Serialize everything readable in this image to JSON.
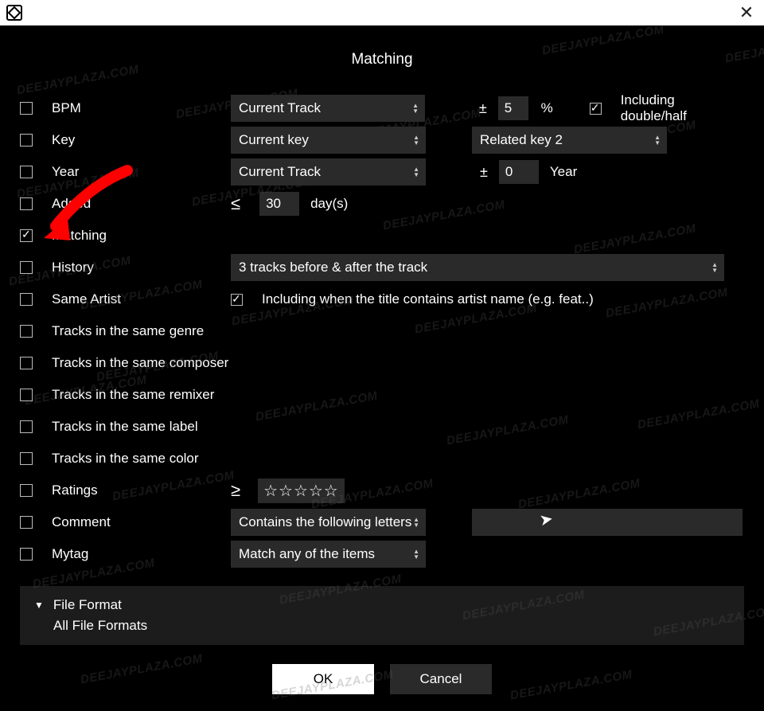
{
  "title": "Matching",
  "watermark": "DEEJAYPLAZA.COM",
  "rows": {
    "bpm": {
      "label": "BPM",
      "select": "Current Track",
      "val": "5",
      "unit": "%",
      "incl_label": "Including double/half"
    },
    "key": {
      "label": "Key",
      "select1": "Current key",
      "select2": "Related key 2"
    },
    "year": {
      "label": "Year",
      "select": "Current Track",
      "val": "0",
      "unit": "Year"
    },
    "added": {
      "label": "Added",
      "val": "30",
      "unit": "day(s)"
    },
    "matching": {
      "label": "Matching"
    },
    "history": {
      "label": "History",
      "select": "3 tracks before & after the track"
    },
    "same_artist": {
      "label": "Same Artist",
      "sub": "Including when the title contains artist name (e.g. feat..)"
    },
    "genre": {
      "label": "Tracks in the same genre"
    },
    "composer": {
      "label": "Tracks in the same composer"
    },
    "remixer": {
      "label": "Tracks in the same remixer"
    },
    "t_label": {
      "label": "Tracks in the same label"
    },
    "color": {
      "label": "Tracks in the same color"
    },
    "ratings": {
      "label": "Ratings",
      "stars": "☆☆☆☆☆"
    },
    "comment": {
      "label": "Comment",
      "select": "Contains the following letters"
    },
    "mytag": {
      "label": "Mytag",
      "select": "Match any of the items"
    }
  },
  "fileFormat": {
    "header": "File Format",
    "sub": "All File Formats"
  },
  "buttons": {
    "ok": "OK",
    "cancel": "Cancel"
  },
  "symbols": {
    "pm": "±",
    "leq": "≤",
    "geq": "≥"
  }
}
